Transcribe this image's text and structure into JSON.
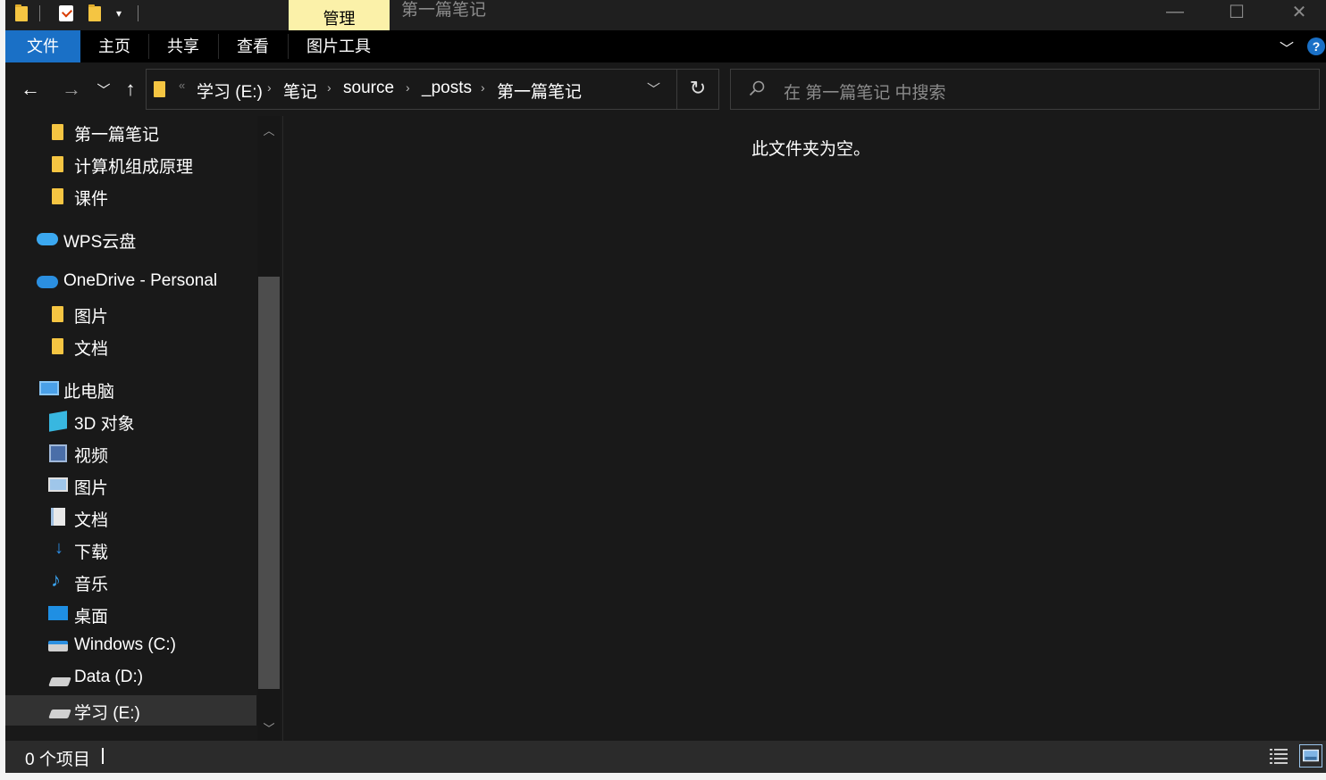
{
  "title_bar": {
    "context_tab": "管理",
    "window_title": "第一篇笔记",
    "minimize_glyph": "—",
    "maximize_glyph": "☐",
    "close_glyph": "✕"
  },
  "ribbon": {
    "tabs": [
      {
        "label": "文件",
        "active": true
      },
      {
        "label": "主页"
      },
      {
        "label": "共享"
      },
      {
        "label": "查看"
      },
      {
        "label": "图片工具"
      }
    ],
    "help_label": "?",
    "accent_color": "#1a70c6"
  },
  "address": {
    "breadcrumbs": [
      "学习 (E:)",
      "笔记",
      "source",
      "_posts",
      "第一篇笔记"
    ]
  },
  "search": {
    "placeholder": "在 第一篇笔记 中搜索"
  },
  "nav_pane": {
    "items": [
      {
        "label": "第一篇笔记",
        "icon": "folder-icon"
      },
      {
        "label": "计算机组成原理",
        "icon": "folder-icon"
      },
      {
        "label": "课件",
        "icon": "folder-icon"
      },
      {
        "label": "WPS云盘",
        "icon": "wps-cloud-icon"
      },
      {
        "label": "OneDrive - Personal",
        "icon": "onedrive-icon"
      },
      {
        "label": "图片",
        "icon": "folder-icon"
      },
      {
        "label": "文档",
        "icon": "folder-icon"
      },
      {
        "label": "此电脑",
        "icon": "computer-icon"
      },
      {
        "label": "3D 对象",
        "icon": "3d-objects-icon"
      },
      {
        "label": "视频",
        "icon": "video-icon"
      },
      {
        "label": "图片",
        "icon": "pictures-icon"
      },
      {
        "label": "文档",
        "icon": "documents-icon"
      },
      {
        "label": "下载",
        "icon": "download-icon"
      },
      {
        "label": "音乐",
        "icon": "music-icon"
      },
      {
        "label": "桌面",
        "icon": "desktop-icon"
      },
      {
        "label": "Windows (C:)",
        "icon": "windows-drive-icon"
      },
      {
        "label": "Data (D:)",
        "icon": "drive-icon"
      },
      {
        "label": "学习 (E:)",
        "icon": "drive-icon",
        "selected": true
      }
    ]
  },
  "content": {
    "empty_message": "此文件夹为空。"
  },
  "status": {
    "item_count": "0 个项目"
  }
}
